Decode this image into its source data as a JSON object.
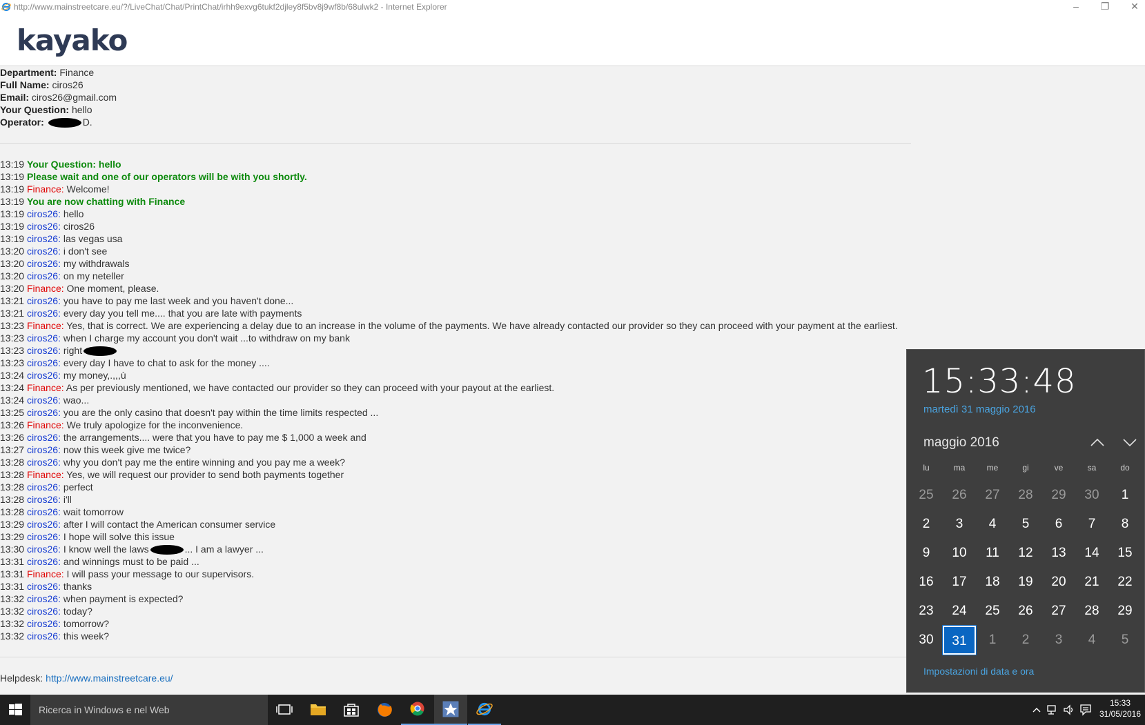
{
  "window": {
    "title": "http://www.mainstreetcare.eu/?/LiveChat/Chat/PrintChat/irhh9exvg6tukf2djley8f5bv8j9wf8b/68ulwk2 - Internet Explorer",
    "minimize": "–",
    "restore": "❐",
    "close": "✕"
  },
  "header": {
    "logo": "kayako"
  },
  "info": [
    {
      "label": "Department:",
      "value": " Finance"
    },
    {
      "label": "Full Name:",
      "value": " ciros26"
    },
    {
      "label": "Email:",
      "value": " ciros26@gmail.com"
    },
    {
      "label": "Your Question:",
      "value": " hello"
    },
    {
      "label": "Operator:",
      "value": "D."
    }
  ],
  "chat": [
    {
      "time": "13:19",
      "kind": "sys",
      "who": "",
      "text": "Your Question: hello"
    },
    {
      "time": "13:19",
      "kind": "sys",
      "who": "",
      "text": "Please wait and one of our operators will be with you shortly."
    },
    {
      "time": "13:19",
      "kind": "fin",
      "who": "Finance:",
      "text": " Welcome!"
    },
    {
      "time": "13:19",
      "kind": "sys",
      "who": "",
      "text": "You are now chatting with Finance"
    },
    {
      "time": "13:19",
      "kind": "cli",
      "who": "ciros26:",
      "text": " hello"
    },
    {
      "time": "13:19",
      "kind": "cli",
      "who": "ciros26:",
      "text": " ciros26"
    },
    {
      "time": "13:19",
      "kind": "cli",
      "who": "ciros26:",
      "text": " las vegas usa"
    },
    {
      "time": "13:20",
      "kind": "cli",
      "who": "ciros26:",
      "text": " i don't see"
    },
    {
      "time": "13:20",
      "kind": "cli",
      "who": "ciros26:",
      "text": " my withdrawals"
    },
    {
      "time": "13:20",
      "kind": "cli",
      "who": "ciros26:",
      "text": " on my neteller"
    },
    {
      "time": "13:20",
      "kind": "fin",
      "who": "Finance:",
      "text": " One moment, please."
    },
    {
      "time": "13:21",
      "kind": "cli",
      "who": "ciros26:",
      "text": " you have to pay me last week and you haven't done..."
    },
    {
      "time": "13:21",
      "kind": "cli",
      "who": "ciros26:",
      "text": " every day you tell me.... that you are late with payments"
    },
    {
      "time": "13:23",
      "kind": "fin",
      "who": "Finance:",
      "text": " Yes, that is correct. We are experiencing a delay due to an increase in the volume of the payments. We have already contacted our provider so they can proceed with your payment at the earliest."
    },
    {
      "time": "13:23",
      "kind": "cli",
      "who": "ciros26:",
      "text": " when I charge my account you don't wait ...to withdraw on my bank"
    },
    {
      "time": "13:23",
      "kind": "cli",
      "who": "ciros26:",
      "text": " right",
      "redact": true
    },
    {
      "time": "13:23",
      "kind": "cli",
      "who": "ciros26:",
      "text": " every day I have to chat to ask for the money ...."
    },
    {
      "time": "13:24",
      "kind": "cli",
      "who": "ciros26:",
      "text": " my money,.,,,ù"
    },
    {
      "time": "13:24",
      "kind": "fin",
      "who": "Finance:",
      "text": " As per previously mentioned, we have contacted our provider so they can proceed with your payout at the earliest."
    },
    {
      "time": "13:24",
      "kind": "cli",
      "who": "ciros26:",
      "text": " wao..."
    },
    {
      "time": "13:25",
      "kind": "cli",
      "who": "ciros26:",
      "text": " you are the only casino that doesn't pay within the time limits respected ..."
    },
    {
      "time": "13:26",
      "kind": "fin",
      "who": "Finance:",
      "text": " We truly apologize for the inconvenience."
    },
    {
      "time": "13:26",
      "kind": "cli",
      "who": "ciros26:",
      "text": " the arrangements.... were that you have to pay me $ 1,000 a week and"
    },
    {
      "time": "13:27",
      "kind": "cli",
      "who": "ciros26:",
      "text": " now this week give me twice?"
    },
    {
      "time": "13:28",
      "kind": "cli",
      "who": "ciros26:",
      "text": " why you don't pay me the entire winning and you pay me a week?"
    },
    {
      "time": "13:28",
      "kind": "fin",
      "who": "Finance:",
      "text": " Yes, we will request our provider to send both payments together"
    },
    {
      "time": "13:28",
      "kind": "cli",
      "who": "ciros26:",
      "text": " perfect"
    },
    {
      "time": "13:28",
      "kind": "cli",
      "who": "ciros26:",
      "text": " i'll"
    },
    {
      "time": "13:28",
      "kind": "cli",
      "who": "ciros26:",
      "text": " wait tomorrow"
    },
    {
      "time": "13:29",
      "kind": "cli",
      "who": "ciros26:",
      "text": " after I will contact the American consumer service"
    },
    {
      "time": "13:29",
      "kind": "cli",
      "who": "ciros26:",
      "text": " I hope will solve this issue"
    },
    {
      "time": "13:30",
      "kind": "cli",
      "who": "ciros26:",
      "text": " I know well the laws",
      "redact": true,
      "tail": "... I am a lawyer ..."
    },
    {
      "time": "13:31",
      "kind": "cli",
      "who": "ciros26:",
      "text": " and winnings must to be paid ..."
    },
    {
      "time": "13:31",
      "kind": "fin",
      "who": "Finance:",
      "text": " I will pass your message to our supervisors."
    },
    {
      "time": "13:31",
      "kind": "cli",
      "who": "ciros26:",
      "text": " thanks"
    },
    {
      "time": "13:32",
      "kind": "cli",
      "who": "ciros26:",
      "text": " when payment is expected?"
    },
    {
      "time": "13:32",
      "kind": "cli",
      "who": "ciros26:",
      "text": " today?"
    },
    {
      "time": "13:32",
      "kind": "cli",
      "who": "ciros26:",
      "text": " tomorrow?"
    },
    {
      "time": "13:32",
      "kind": "cli",
      "who": "ciros26:",
      "text": " this week?"
    }
  ],
  "footer": {
    "label": "Helpdesk: ",
    "link": "http://www.mainstreetcare.eu/"
  },
  "flyout": {
    "time": "15:33:48",
    "date_long": "martedì 31 maggio 2016",
    "month": "maggio 2016",
    "weekdays": [
      "lu",
      "ma",
      "me",
      "gi",
      "ve",
      "sa",
      "do"
    ],
    "days": [
      {
        "d": "25",
        "m": true
      },
      {
        "d": "26",
        "m": true
      },
      {
        "d": "27",
        "m": true
      },
      {
        "d": "28",
        "m": true
      },
      {
        "d": "29",
        "m": true
      },
      {
        "d": "30",
        "m": true
      },
      {
        "d": "1"
      },
      {
        "d": "2"
      },
      {
        "d": "3"
      },
      {
        "d": "4"
      },
      {
        "d": "5"
      },
      {
        "d": "6"
      },
      {
        "d": "7"
      },
      {
        "d": "8"
      },
      {
        "d": "9"
      },
      {
        "d": "10"
      },
      {
        "d": "11"
      },
      {
        "d": "12"
      },
      {
        "d": "13"
      },
      {
        "d": "14"
      },
      {
        "d": "15"
      },
      {
        "d": "16"
      },
      {
        "d": "17"
      },
      {
        "d": "18"
      },
      {
        "d": "19"
      },
      {
        "d": "20"
      },
      {
        "d": "21"
      },
      {
        "d": "22"
      },
      {
        "d": "23"
      },
      {
        "d": "24"
      },
      {
        "d": "25"
      },
      {
        "d": "26"
      },
      {
        "d": "27"
      },
      {
        "d": "28"
      },
      {
        "d": "29"
      },
      {
        "d": "30"
      },
      {
        "d": "31",
        "today": true
      },
      {
        "d": "1",
        "m": true
      },
      {
        "d": "2",
        "m": true
      },
      {
        "d": "3",
        "m": true
      },
      {
        "d": "4",
        "m": true
      },
      {
        "d": "5",
        "m": true
      }
    ],
    "settings": "Impostazioni di data e ora"
  },
  "taskbar": {
    "search_placeholder": "Ricerca in Windows e nel Web",
    "time": "15:33",
    "date": "31/05/2016",
    "icons": [
      "task-view-icon",
      "file-explorer-icon",
      "store-icon",
      "firefox-icon",
      "chrome-icon",
      "star-app-icon",
      "internet-explorer-icon"
    ]
  },
  "colors": {
    "system": "#0d8a0d",
    "finance": "#e00000",
    "client": "#1a3fd3",
    "accent": "#0a66c2",
    "link": "#4aa3df"
  }
}
